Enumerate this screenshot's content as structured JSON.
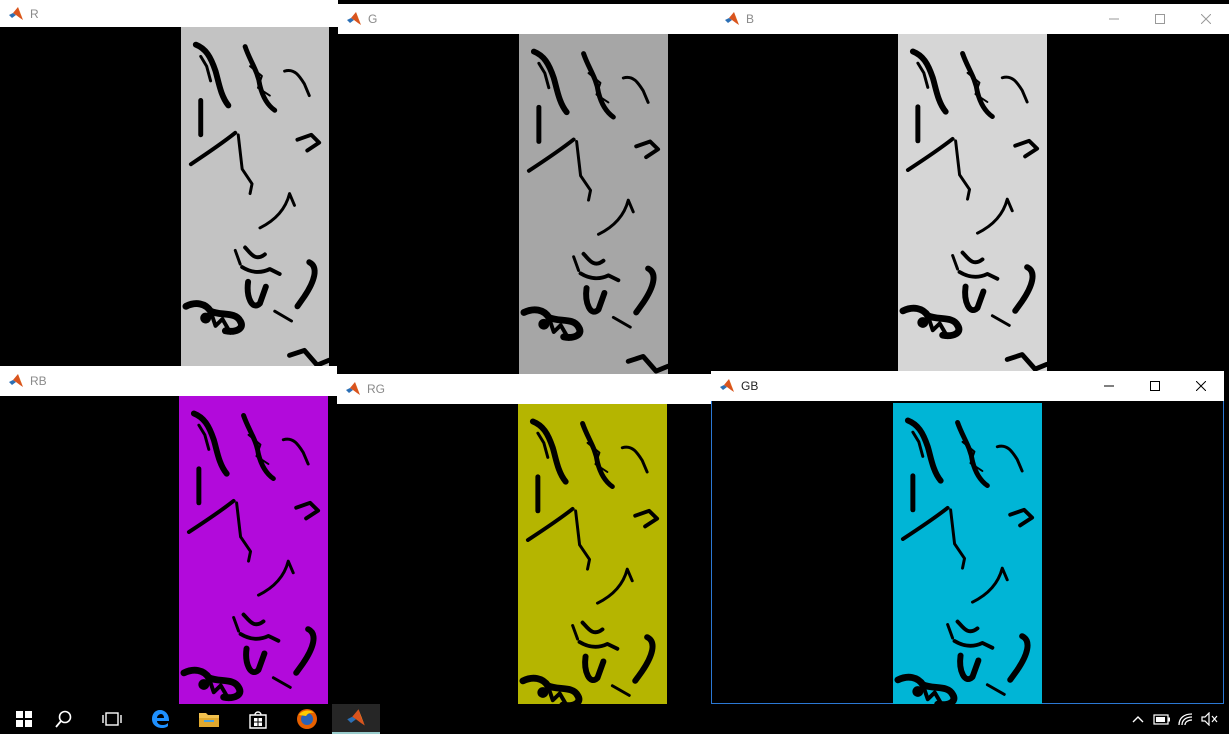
{
  "windows": [
    {
      "id": "R",
      "title": "R",
      "tint": "#c3c3c3",
      "active": false,
      "controls": false
    },
    {
      "id": "G",
      "title": "G",
      "tint": "#a6a6a6",
      "active": false,
      "controls": false
    },
    {
      "id": "B",
      "title": "B",
      "tint": "#d6d6d6",
      "active": false,
      "controls": true
    },
    {
      "id": "RB",
      "title": "RB",
      "tint": "#b20adb",
      "active": false,
      "controls": false
    },
    {
      "id": "RG",
      "title": "RG",
      "tint": "#b5b500",
      "active": false,
      "controls": false
    },
    {
      "id": "GB",
      "title": "GB",
      "tint": "#00b5d6",
      "active": true,
      "controls": true
    }
  ],
  "window_controls": {
    "minimize_icon": "minimize-icon",
    "maximize_icon": "maximize-icon",
    "close_icon": "close-icon"
  },
  "taskbar": {
    "apps": [
      "start-icon",
      "search-icon",
      "task-view-icon",
      "edge-icon",
      "file-explorer-icon",
      "store-icon",
      "firefox-icon",
      "matlab-icon"
    ],
    "active_app": "matlab-icon",
    "tray": [
      "chevron-up-icon",
      "battery-icon",
      "wifi-icon",
      "speaker-muted-icon"
    ]
  }
}
